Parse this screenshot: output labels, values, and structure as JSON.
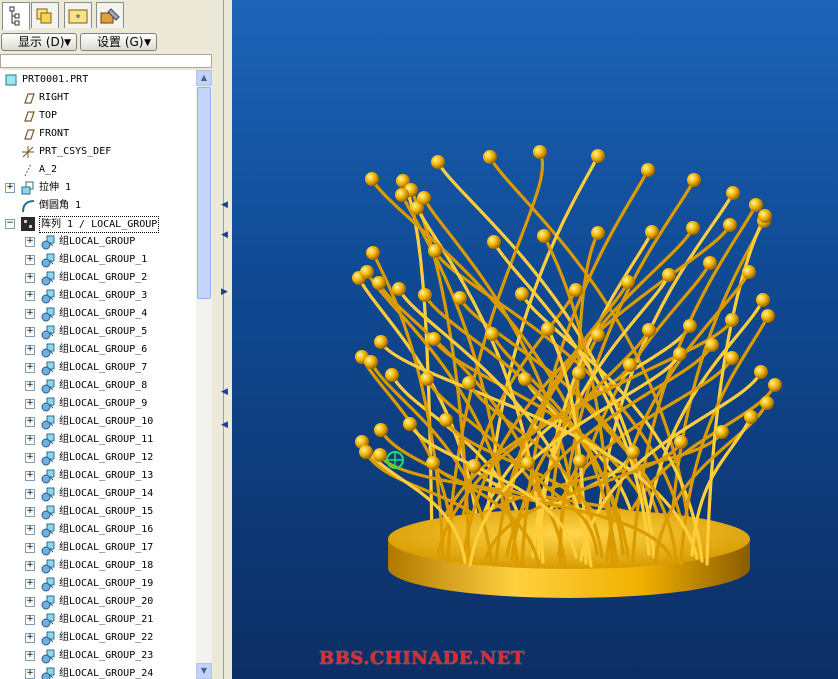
{
  "toolbar": {
    "show_label": "显示 (D)",
    "settings_label": "设置 (G)"
  },
  "tabs": [
    {
      "icon": "model-tree-icon",
      "active": true
    },
    {
      "icon": "folder-browser-icon",
      "active": false
    },
    {
      "icon": "favorites-icon",
      "active": false
    },
    {
      "icon": "connections-icon",
      "active": false
    }
  ],
  "tree": {
    "items": [
      {
        "label": "PRT0001.PRT",
        "icon": "part-icon",
        "indent": 0,
        "expander": "none"
      },
      {
        "label": "RIGHT",
        "icon": "datum-plane-icon",
        "indent": 1,
        "expander": "none"
      },
      {
        "label": "TOP",
        "icon": "datum-plane-icon",
        "indent": 1,
        "expander": "none"
      },
      {
        "label": "FRONT",
        "icon": "datum-plane-icon",
        "indent": 1,
        "expander": "none"
      },
      {
        "label": "PRT_CSYS_DEF",
        "icon": "coordinate-system-icon",
        "indent": 1,
        "expander": "none"
      },
      {
        "label": "A_2",
        "icon": "datum-axis-icon",
        "indent": 1,
        "expander": "none"
      },
      {
        "label": "拉伸 1",
        "icon": "extrude-icon",
        "indent": 1,
        "expander": "plus"
      },
      {
        "label": "倒圆角 1",
        "icon": "round-icon",
        "indent": 1,
        "expander": "none"
      },
      {
        "label": "阵列 1 / LOCAL_GROUP",
        "icon": "pattern-icon",
        "indent": 1,
        "expander": "minus",
        "selected": true
      },
      {
        "label": "组LOCAL_GROUP",
        "icon": "group-icon",
        "indent": 2,
        "expander": "plus"
      },
      {
        "label": "组LOCAL_GROUP_1",
        "icon": "group-icon",
        "indent": 2,
        "expander": "plus"
      },
      {
        "label": "组LOCAL_GROUP_2",
        "icon": "group-icon",
        "indent": 2,
        "expander": "plus"
      },
      {
        "label": "组LOCAL_GROUP_3",
        "icon": "group-icon",
        "indent": 2,
        "expander": "plus"
      },
      {
        "label": "组LOCAL_GROUP_4",
        "icon": "group-icon",
        "indent": 2,
        "expander": "plus"
      },
      {
        "label": "组LOCAL_GROUP_5",
        "icon": "group-icon",
        "indent": 2,
        "expander": "plus"
      },
      {
        "label": "组LOCAL_GROUP_6",
        "icon": "group-icon",
        "indent": 2,
        "expander": "plus"
      },
      {
        "label": "组LOCAL_GROUP_7",
        "icon": "group-icon",
        "indent": 2,
        "expander": "plus"
      },
      {
        "label": "组LOCAL_GROUP_8",
        "icon": "group-icon",
        "indent": 2,
        "expander": "plus"
      },
      {
        "label": "组LOCAL_GROUP_9",
        "icon": "group-icon",
        "indent": 2,
        "expander": "plus"
      },
      {
        "label": "组LOCAL_GROUP_10",
        "icon": "group-icon",
        "indent": 2,
        "expander": "plus"
      },
      {
        "label": "组LOCAL_GROUP_11",
        "icon": "group-icon",
        "indent": 2,
        "expander": "plus"
      },
      {
        "label": "组LOCAL_GROUP_12",
        "icon": "group-icon",
        "indent": 2,
        "expander": "plus"
      },
      {
        "label": "组LOCAL_GROUP_13",
        "icon": "group-icon",
        "indent": 2,
        "expander": "plus"
      },
      {
        "label": "组LOCAL_GROUP_14",
        "icon": "group-icon",
        "indent": 2,
        "expander": "plus"
      },
      {
        "label": "组LOCAL_GROUP_15",
        "icon": "group-icon",
        "indent": 2,
        "expander": "plus"
      },
      {
        "label": "组LOCAL_GROUP_16",
        "icon": "group-icon",
        "indent": 2,
        "expander": "plus"
      },
      {
        "label": "组LOCAL_GROUP_17",
        "icon": "group-icon",
        "indent": 2,
        "expander": "plus"
      },
      {
        "label": "组LOCAL_GROUP_18",
        "icon": "group-icon",
        "indent": 2,
        "expander": "plus"
      },
      {
        "label": "组LOCAL_GROUP_19",
        "icon": "group-icon",
        "indent": 2,
        "expander": "plus"
      },
      {
        "label": "组LOCAL_GROUP_20",
        "icon": "group-icon",
        "indent": 2,
        "expander": "plus"
      },
      {
        "label": "组LOCAL_GROUP_21",
        "icon": "group-icon",
        "indent": 2,
        "expander": "plus"
      },
      {
        "label": "组LOCAL_GROUP_22",
        "icon": "group-icon",
        "indent": 2,
        "expander": "plus"
      },
      {
        "label": "组LOCAL_GROUP_23",
        "icon": "group-icon",
        "indent": 2,
        "expander": "plus"
      },
      {
        "label": "组LOCAL_GROUP_24",
        "icon": "group-icon",
        "indent": 2,
        "expander": "plus"
      }
    ]
  },
  "watermark": "BBS.CHINADE.NET",
  "colors": {
    "viewport_top": "#1d64b8",
    "viewport_bottom": "#0c2e64",
    "model_gold": "#f0b000",
    "watermark_red": "#d92e2e",
    "selection": "#0a246a"
  }
}
